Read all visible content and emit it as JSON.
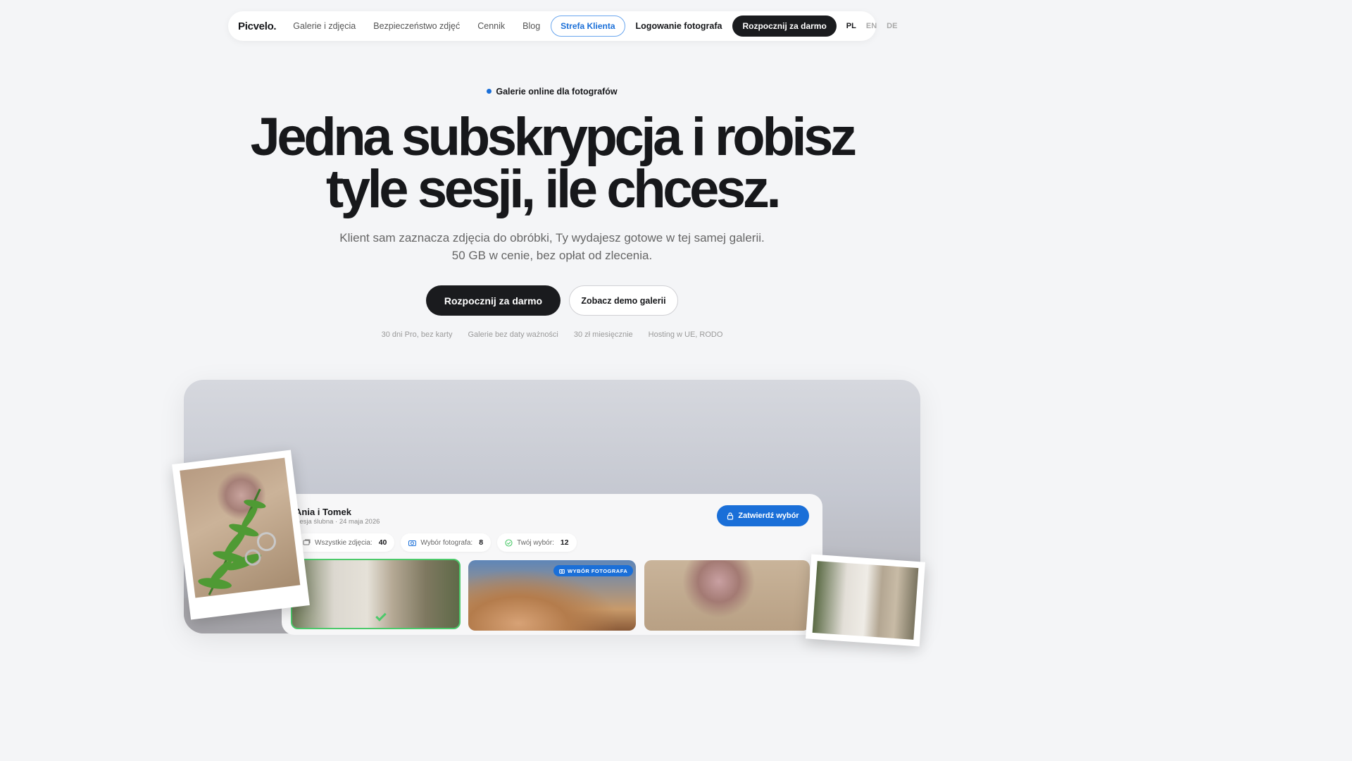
{
  "nav": {
    "logo": "Picvelo.",
    "links": [
      "Galerie i zdjęcia",
      "Bezpieczeństwo zdjęć",
      "Cennik",
      "Blog"
    ],
    "client_zone": "Strefa Klienta",
    "login": "Logowanie fotografa",
    "start": "Rozpocznij za darmo",
    "langs": [
      "PL",
      "EN",
      "DE"
    ],
    "active_lang": "PL"
  },
  "hero": {
    "eyebrow": "Galerie online dla fotografów",
    "headline_line1": "Jedna subskrypcja i robisz",
    "headline_line2": "tyle sesji, ile chcesz.",
    "sub_line1": "Klient sam zaznacza zdjęcia do obróbki, Ty wydajesz gotowe w tej samej galerii.",
    "sub_line2": "50 GB w cenie, bez opłat od zlecenia.",
    "cta_primary": "Rozpocznij za darmo",
    "cta_secondary": "Zobacz demo galerii",
    "perks": [
      "30 dni Pro, bez karty",
      "Galerie bez daty ważności",
      "30 zł miesięcznie",
      "Hosting w UE, RODO"
    ]
  },
  "gallery": {
    "client_name": "Ania i Tomek",
    "meta": "Sesja ślubna · 24 maja 2026",
    "confirm": "Zatwierdź wybór",
    "pills": [
      {
        "label": "Wszystkie zdjęcia:",
        "count": "40",
        "icon": "stack-icon"
      },
      {
        "label": "Wybór fotografa:",
        "count": "8",
        "icon": "camera-icon"
      },
      {
        "label": "Twój wybór:",
        "count": "12",
        "icon": "check-circle-icon"
      }
    ],
    "badge": "WYBÓR FOTOGRAFA"
  },
  "colors": {
    "accent": "#1a6fd8",
    "dark": "#1a1b1e",
    "selected": "#4cc96a"
  }
}
